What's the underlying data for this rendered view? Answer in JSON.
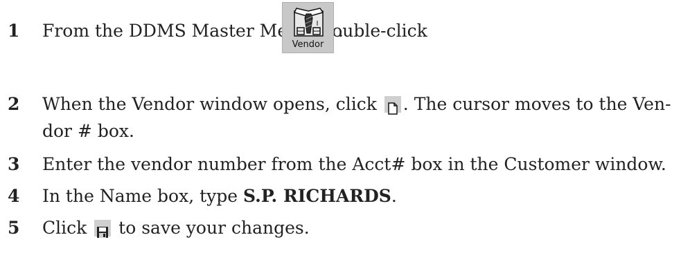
{
  "steps": [
    {
      "number": "1",
      "before": "From the DDMS Master Menu, double-click ",
      "after": "."
    },
    {
      "number": "2",
      "line1_before": "When the Vendor window opens, click ",
      "line1_after": ". The cursor moves to the Ven-",
      "line2": "dor # box."
    },
    {
      "number": "3",
      "text": "Enter the vendor number from the Acct# box in the Customer window."
    },
    {
      "number": "4",
      "before": "In the Name box, type ",
      "bold": "S.P. RICHARDS",
      "after": "."
    },
    {
      "number": "5",
      "before": "Click ",
      "after": " to save your changes."
    }
  ],
  "vendor_button": {
    "label": "Vendor",
    "icon": "shirt-tie-icon"
  },
  "new_icon": "new-document-icon",
  "save_icon": "floppy-disk-icon"
}
